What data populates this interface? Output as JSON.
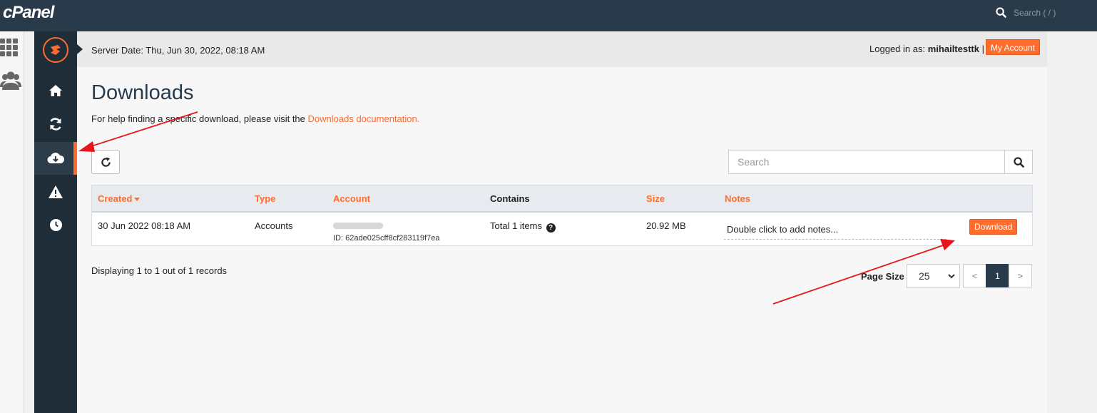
{
  "app": {
    "logo": "cPanel"
  },
  "topbar": {
    "search_placeholder": "Search ( / )"
  },
  "header": {
    "server_date": "Server Date: Thu, Jun 30, 2022, 08:18 AM",
    "logged_in_label": "Logged in as:",
    "username": "mihailtesttk",
    "separator": "|",
    "my_account": "My Account"
  },
  "sidebar": {
    "items": [
      {
        "name": "home",
        "icon": "home-icon"
      },
      {
        "name": "transfers",
        "icon": "refresh-icon"
      },
      {
        "name": "downloads",
        "icon": "cloud-download-icon",
        "active": true
      },
      {
        "name": "alerts",
        "icon": "warning-icon"
      },
      {
        "name": "history",
        "icon": "clock-icon"
      }
    ]
  },
  "page": {
    "title": "Downloads",
    "help_text": "For help finding a specific download, please visit the ",
    "help_link": "Downloads documentation."
  },
  "search": {
    "placeholder": "Search"
  },
  "table": {
    "headers": {
      "created": "Created",
      "type": "Type",
      "account": "Account",
      "contains": "Contains",
      "size": "Size",
      "notes": "Notes"
    },
    "rows": [
      {
        "created": "30 Jun 2022 08:18 AM",
        "type": "Accounts",
        "account_id": "ID: 62ade025cff8cf283119f7ea",
        "contains": "Total 1 items",
        "size": "20.92 MB",
        "notes": "Double click to add notes...",
        "action": "Download"
      }
    ]
  },
  "footer": {
    "displaying": "Displaying 1 to 1 out of 1 records",
    "page_size_label": "Page Size",
    "page_size_value": "25",
    "prev": "<",
    "current_page": "1",
    "next": ">"
  },
  "colors": {
    "accent": "#ff6c2c",
    "dark": "#1f2d38",
    "topbar": "#293a4a",
    "annotation": "#e8141b"
  }
}
